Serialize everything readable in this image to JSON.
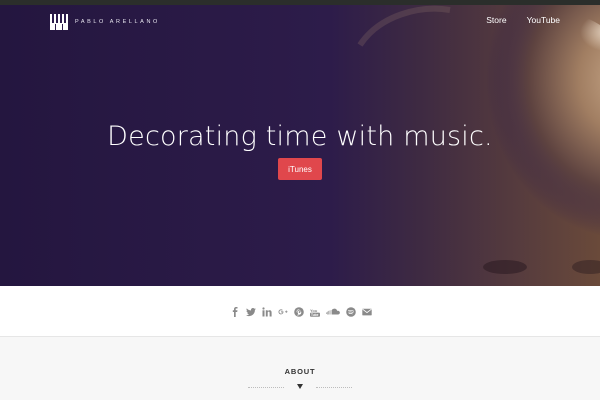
{
  "brand": {
    "name": "PABLO ARELLANO",
    "logo_icon": "piano-keys-icon"
  },
  "nav": {
    "items": [
      {
        "label": "Store"
      },
      {
        "label": "YouTube"
      }
    ]
  },
  "hero": {
    "headline": "Decorating time with music.",
    "cta_label": "iTunes",
    "cta_color": "#e0474c",
    "overlay_color": "#2a1a4a"
  },
  "social": {
    "icons": [
      "facebook-icon",
      "twitter-icon",
      "linkedin-icon",
      "google-plus-icon",
      "pinterest-icon",
      "youtube-icon",
      "soundcloud-icon",
      "spotify-icon",
      "email-icon"
    ],
    "icon_color": "#8a8a8a"
  },
  "about": {
    "title": "ABOUT"
  }
}
